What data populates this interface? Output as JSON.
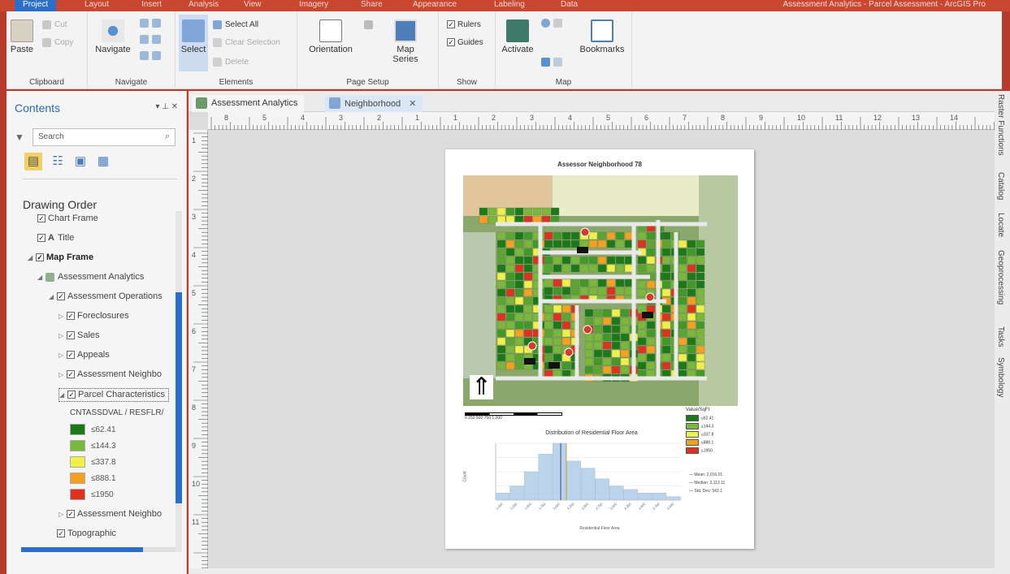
{
  "ribbon_tabs": [
    {
      "label": "Project",
      "active": true
    },
    {
      "label": "Layout"
    },
    {
      "label": "Insert"
    },
    {
      "label": "Analysis"
    },
    {
      "label": "View"
    },
    {
      "label": "Imagery"
    },
    {
      "label": "Share"
    },
    {
      "label": "Appearance"
    },
    {
      "label": "Labeling"
    },
    {
      "label": "Data"
    }
  ],
  "window_title": "Assessment Analytics - Parcel Assessment - ArcGIS Pro",
  "ribbon": {
    "clipboard": {
      "paste": "Paste",
      "cut": "Cut",
      "copy": "Copy",
      "label": "Clipboard"
    },
    "navigate": {
      "navigate": "Navigate",
      "label": "Navigate"
    },
    "elements": {
      "select": "Select",
      "select_all": "Select All",
      "clear_selection": "Clear Selection",
      "delete": "Delete",
      "label": "Elements"
    },
    "page_setup": {
      "orientation": "Orientation",
      "map_series": "Map Series",
      "label": "Page Setup"
    },
    "show": {
      "rulers": "Rulers",
      "guides": "Guides",
      "label": "Show"
    },
    "map": {
      "activate": "Activate",
      "bookmarks": "Bookmarks",
      "label": "Map"
    }
  },
  "contents": {
    "title": "Contents",
    "pane_controls": "▾ ⊥ ✕",
    "search_placeholder": "Search",
    "drawing_order": "Drawing Order",
    "items": [
      {
        "label": "Chart Frame"
      },
      {
        "label": "Title"
      },
      {
        "label": "Map Frame"
      },
      {
        "label": "Assessment Analytics"
      },
      {
        "label": "Assessment Operations"
      },
      {
        "label": "Foreclosures"
      },
      {
        "label": "Sales"
      },
      {
        "label": "Appeals"
      },
      {
        "label": "Assessment Neighbo"
      },
      {
        "label": "Parcel Characteristics"
      },
      {
        "label": "CNTASSDVAL / RESFLR/"
      },
      {
        "label": "Assessment Neighbo"
      },
      {
        "label": "Topographic"
      }
    ],
    "legend": [
      {
        "label": "≤62.41",
        "color": "#1a7a1a"
      },
      {
        "label": "≤144.3",
        "color": "#79b83a"
      },
      {
        "label": "≤337.8",
        "color": "#f0f04a"
      },
      {
        "label": "≤888.1",
        "color": "#f5a020"
      },
      {
        "label": "≤1950",
        "color": "#e03020"
      }
    ]
  },
  "view_tabs": [
    {
      "label": "Assessment Analytics",
      "active": false
    },
    {
      "label": "Neighborhood",
      "active": true
    }
  ],
  "layout": {
    "ruler_h": [
      "8",
      "5",
      "4",
      "3",
      "2",
      "1",
      "1",
      "2",
      "3",
      "4",
      "5",
      "6",
      "7",
      "8",
      "9",
      "10",
      "11",
      "12",
      "13",
      "14"
    ],
    "ruler_v": [
      "1",
      "2",
      "3",
      "4",
      "5",
      "6",
      "7",
      "8",
      "9",
      "10",
      "11"
    ],
    "page": {
      "title": "Assessor Neighborhood 78",
      "scale_text": "0  250  500  750  1,000",
      "legend_title": "Value/SqFt",
      "chart_title": "Distribution of Residential Floor Area",
      "chart_x_label": "Residential Floor Area",
      "chart_y_label": "Count",
      "chart_legend": [
        "— Mean: 2,016.01",
        "— Median: 2,113.11",
        "— Std. Dev: 543.1"
      ]
    }
  },
  "chart_data": {
    "type": "bar",
    "title": "Distribution of Residential Floor Area",
    "xlabel": "Residential Floor Area",
    "ylabel": "Count",
    "categories": [
      "1,000",
      "1,250",
      "1,500",
      "1,750",
      "2,000",
      "2,250",
      "2,500",
      "2,750",
      "3,000",
      "3,250",
      "3,500",
      "3,750",
      "4,000"
    ],
    "values": [
      2,
      4,
      8,
      13,
      16,
      11,
      9,
      6,
      4,
      3,
      2,
      2,
      1
    ],
    "ylim": [
      0,
      16
    ],
    "reference_lines": {
      "mean": 2016,
      "median": 2113
    }
  },
  "right_dock": [
    "Raster Functions",
    "Catalog",
    "Locate",
    "Geoprocessing",
    "Tasks",
    "Symbology"
  ]
}
